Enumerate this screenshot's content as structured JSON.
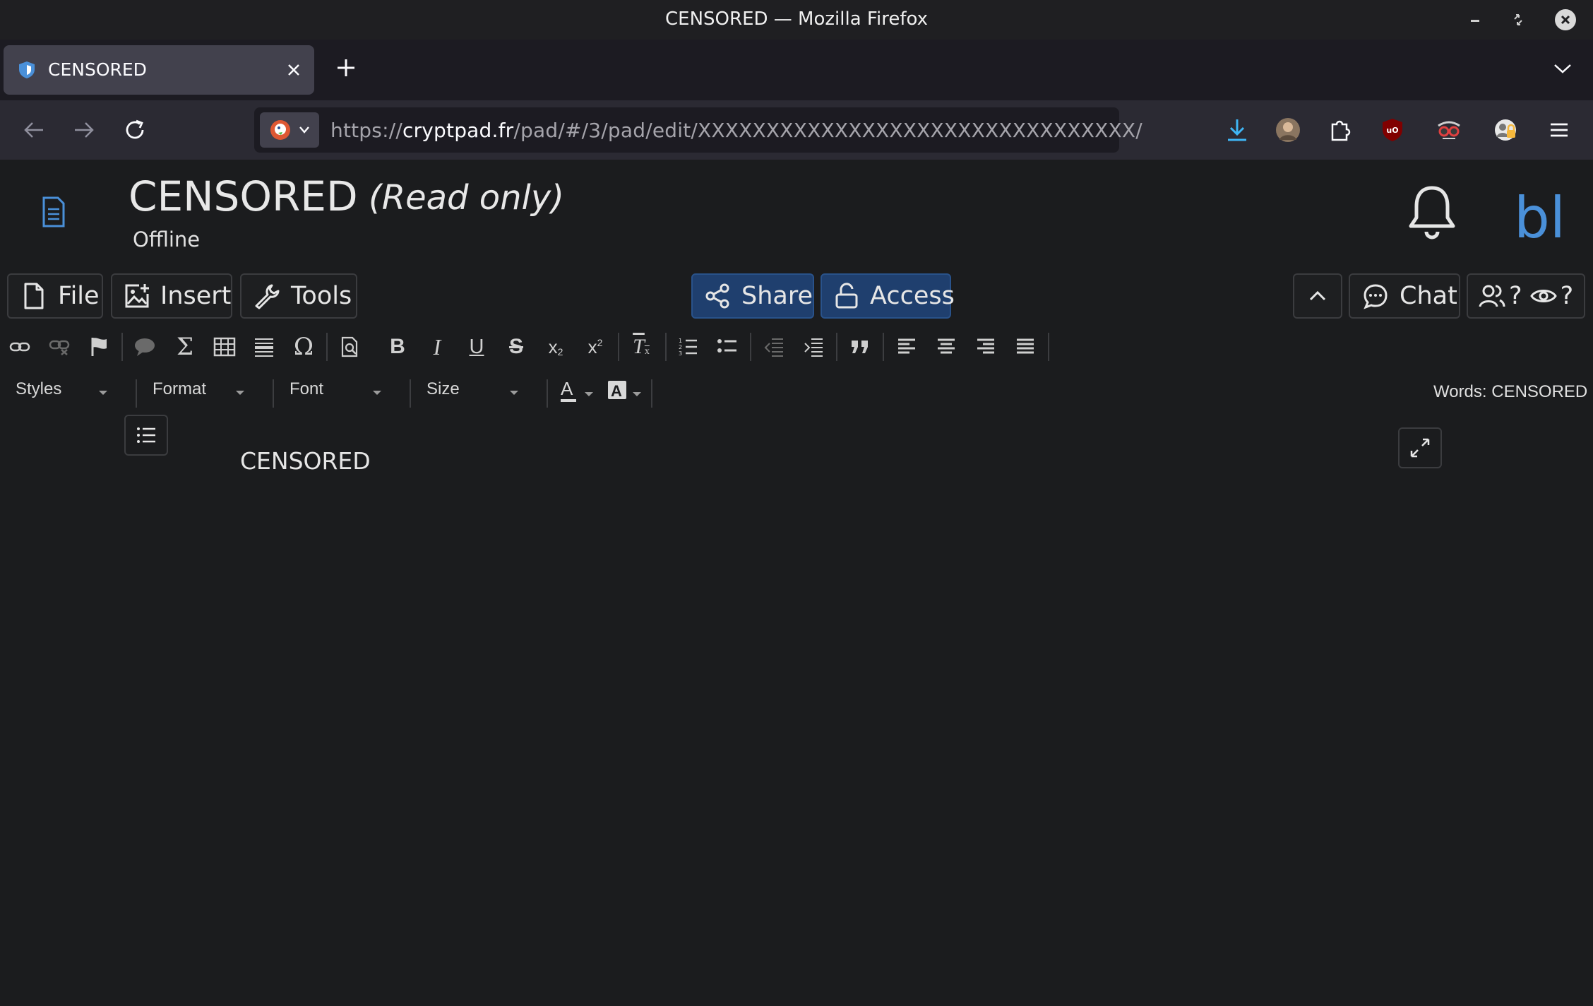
{
  "window": {
    "title": "CENSORED — Mozilla Firefox"
  },
  "tab": {
    "title": "CENSORED"
  },
  "urlbar": {
    "scheme": "https://",
    "host": "cryptpad.fr",
    "path": "/pad/#/3/pad/edit/XXXXXXXXXXXXXXXXXXXXXXXXXXXXXXXX/"
  },
  "app": {
    "title": "CENSORED",
    "mode": "(Read only)",
    "status": "Offline",
    "user_initials": "bl"
  },
  "toolbar": {
    "file": "File",
    "insert": "Insert",
    "tools": "Tools",
    "share": "Share",
    "access": "Access",
    "chat": "Chat",
    "users_count": "?",
    "viewers_count": "?"
  },
  "editor": {
    "styles": "Styles",
    "format": "Format",
    "font": "Font",
    "size": "Size",
    "word_count": "Words: CENSORED",
    "content": "CENSORED"
  },
  "icons": [
    "link-icon",
    "unlink-icon",
    "anchor-flag-icon",
    "comment-icon",
    "math-sigma-icon",
    "table-icon",
    "horizontal-rule-icon",
    "special-char-omega-icon",
    "find-icon",
    "bold-icon",
    "italic-icon",
    "underline-icon",
    "strike-icon",
    "subscript-icon",
    "superscript-icon",
    "remove-format-icon",
    "numbered-list-icon",
    "bulleted-list-icon",
    "outdent-icon",
    "indent-icon",
    "blockquote-icon",
    "align-left-icon",
    "align-center-icon",
    "align-right-icon",
    "justify-icon"
  ],
  "colors": {
    "accent": "#4a90d9",
    "primary_button": "#1f3f6e",
    "background": "#1b1c1e"
  }
}
